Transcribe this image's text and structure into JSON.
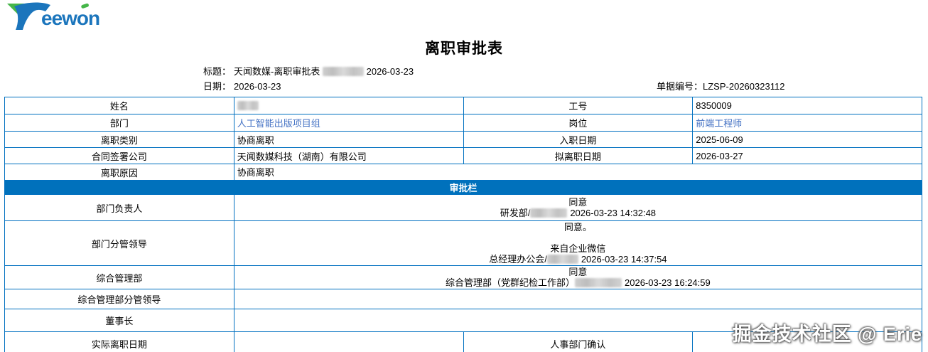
{
  "brand": {
    "wordmark": "eewon",
    "full_name": "Teewon"
  },
  "colors": {
    "banner_blue": "#0071BC",
    "border_blue": "#0070C0",
    "link_blue": "#4472C4",
    "logo_blue": "#1B75BC",
    "logo_green": "#45B649"
  },
  "page_title": "离职审批表",
  "meta": {
    "title_label": "标题：",
    "title_value": "天闻数媒-离职审批表",
    "title_suffix": "2026-03-23",
    "date_label": "日期：",
    "date_value": "2026-03-23",
    "doc_label": "单据编号：",
    "doc_value": "LZSP-20260323112"
  },
  "fields": {
    "name_label": "姓名",
    "emp_no_label": "工号",
    "emp_no": "8350009",
    "dept_label": "部门",
    "dept": "人工智能出版项目组",
    "post_label": "岗位",
    "post": "前端工程师",
    "type_label": "离职类别",
    "type": "协商离职",
    "hire_date_label": "入职日期",
    "hire_date": "2025-06-09",
    "company_label": "合同签署公司",
    "company": "天闻数媒科技（湖南）有限公司",
    "plan_date_label": "拟离职日期",
    "plan_date": "2026-03-27",
    "reason_label": "离职原因",
    "reason": "协商离职"
  },
  "section_header": "审批栏",
  "approvals": {
    "dept_head": {
      "label": "部门负责人",
      "line1": "同意",
      "by_prefix": "研发部/",
      "by_suffix": "2026-03-23 14:32:48"
    },
    "dept_leader": {
      "label": "部门分管领导",
      "line1": "同意。",
      "line2": "来自企业微信",
      "by_prefix": "总经理办公会/",
      "by_suffix": "2026-03-23 14:37:54"
    },
    "admin_dept": {
      "label": "综合管理部",
      "line1": "同意",
      "by_prefix": "综合管理部（党群纪检工作部）",
      "by_suffix": "2026-03-23 16:24:59"
    },
    "admin_leader": {
      "label": "综合管理部分管领导"
    },
    "chairman": {
      "label": "董事长"
    }
  },
  "footer_row": {
    "actual_date_label": "实际离职日期",
    "hr_confirm_label": "人事部门确认"
  },
  "watermark": "掘金技术社区 @ Erie"
}
